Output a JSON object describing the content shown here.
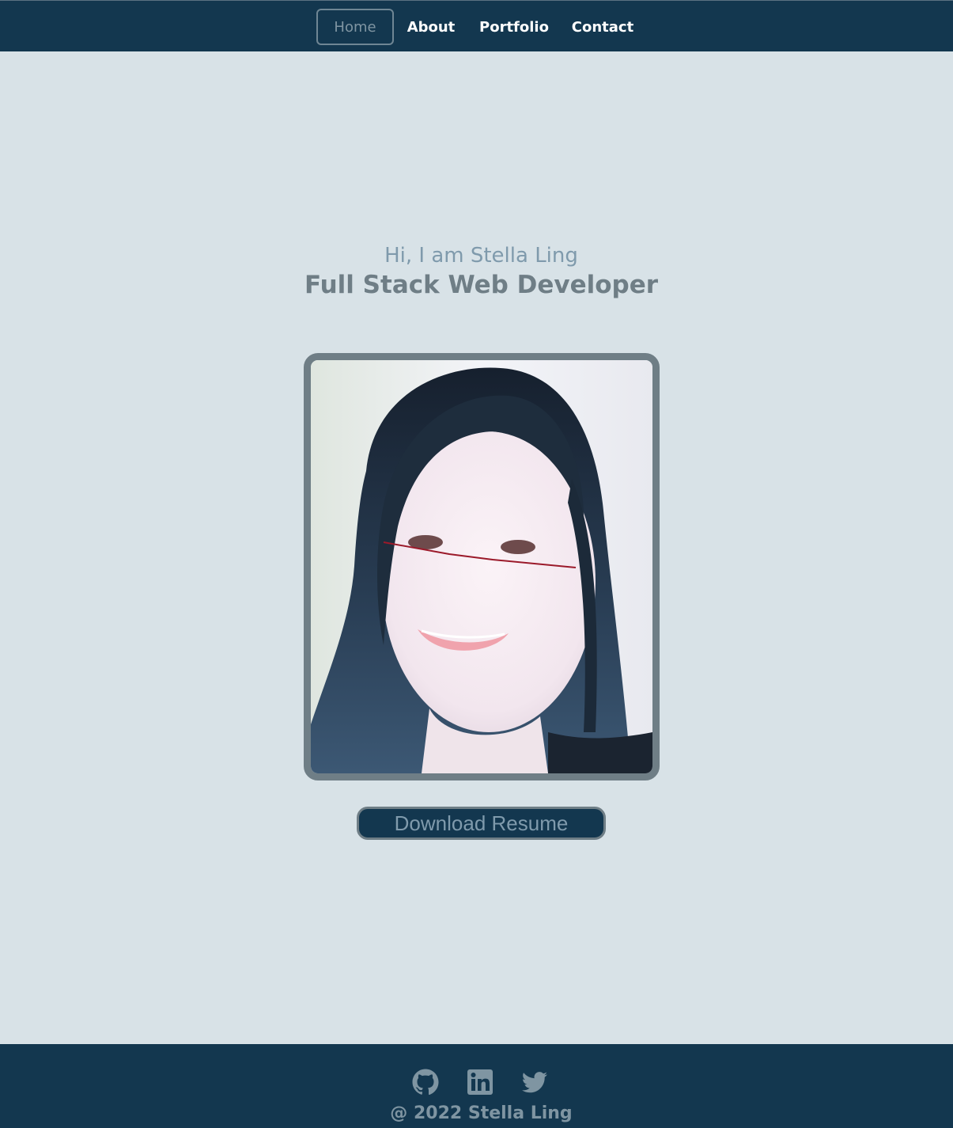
{
  "nav": {
    "items": [
      {
        "label": "Home",
        "active": true
      },
      {
        "label": "About",
        "active": false
      },
      {
        "label": "Portfolio",
        "active": false
      },
      {
        "label": "Contact",
        "active": false
      }
    ]
  },
  "hero": {
    "greeting": "Hi, I am Stella Ling",
    "title": "Full Stack Web Developer",
    "resume_button": "Download Resume"
  },
  "footer": {
    "social_icons": [
      "github-icon",
      "linkedin-icon",
      "twitter-icon"
    ],
    "copyright": "@ 2022 Stella Ling"
  },
  "colors": {
    "navbar_bg": "#13374f",
    "page_bg": "#d8e2e7",
    "accent_muted": "#7f9aac",
    "frame_border": "#6f7e86"
  }
}
